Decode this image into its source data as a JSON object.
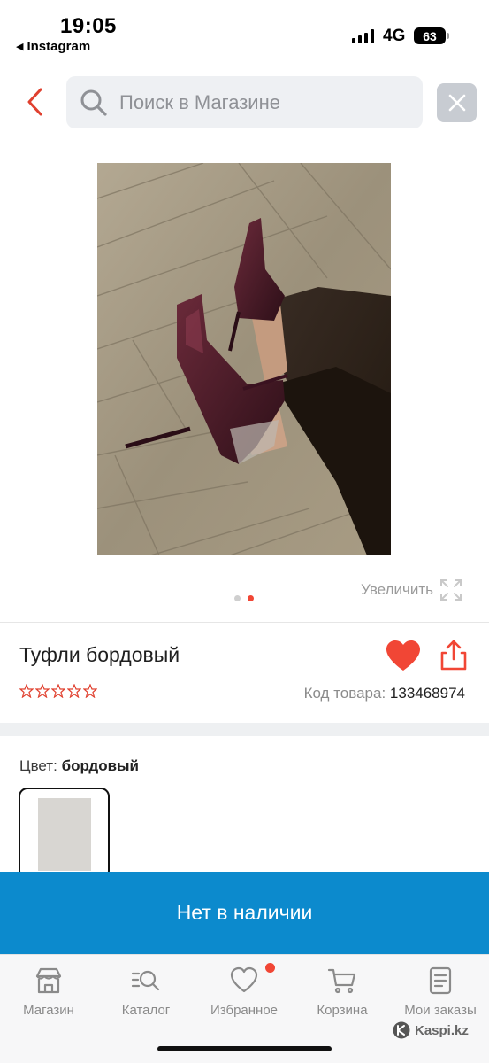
{
  "status_bar": {
    "time": "19:05",
    "back_app": "Instagram",
    "network": "4G",
    "battery": "63"
  },
  "search": {
    "placeholder": "Поиск в Магазине",
    "back_icon": "chevron-left-icon",
    "search_icon": "search-icon",
    "clear_icon": "close-icon"
  },
  "gallery": {
    "zoom_label": "Увеличить",
    "zoom_icon": "expand-icon",
    "total_slides": 2,
    "active_slide": 2
  },
  "product": {
    "title": "Туфли бордовый",
    "rating_stars": 0,
    "rating_max": 5,
    "sku_label": "Код товара:",
    "sku_value": "133468974",
    "favorite_icon": "heart-icon",
    "share_icon": "share-icon"
  },
  "color": {
    "label": "Цвет:",
    "value": "бордовый"
  },
  "cta": {
    "label": "Нет в наличии"
  },
  "bottom_nav": {
    "items": [
      {
        "label": "Магазин",
        "icon": "store-icon"
      },
      {
        "label": "Каталог",
        "icon": "catalog-search-icon"
      },
      {
        "label": "Избранное",
        "icon": "heart-outline-icon",
        "badge": true
      },
      {
        "label": "Корзина",
        "icon": "cart-icon"
      },
      {
        "label": "Мои заказы",
        "icon": "orders-icon"
      }
    ]
  },
  "watermark": {
    "text": "Kaspi.kz"
  },
  "colors": {
    "accent_red": "#f14635",
    "primary_blue": "#0c8acd",
    "search_bg": "#eef0f3"
  }
}
